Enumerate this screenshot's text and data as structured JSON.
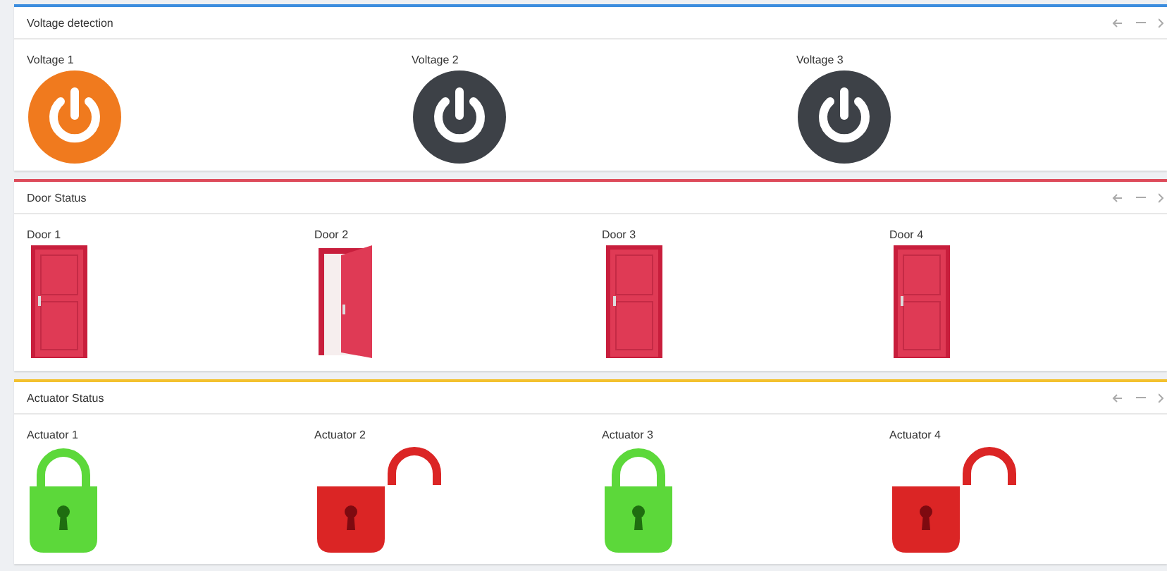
{
  "panels": [
    {
      "title": "Voltage detection",
      "color": "#3c8dde",
      "kind": "power",
      "items": [
        {
          "label": "Voltage 1",
          "on": true
        },
        {
          "label": "Voltage 2",
          "on": false
        },
        {
          "label": "Voltage 3",
          "on": false
        }
      ]
    },
    {
      "title": "Door Status",
      "color": "#dd4b5a",
      "kind": "door",
      "items": [
        {
          "label": "Door 1",
          "open": false
        },
        {
          "label": "Door 2",
          "open": true
        },
        {
          "label": "Door 3",
          "open": false
        },
        {
          "label": "Door 4",
          "open": false
        }
      ]
    },
    {
      "title": "Actuator Status",
      "color": "#f3c12e",
      "kind": "lock",
      "items": [
        {
          "label": "Actuator 1",
          "locked": true
        },
        {
          "label": "Actuator 2",
          "locked": false
        },
        {
          "label": "Actuator 3",
          "locked": true
        },
        {
          "label": "Actuator 4",
          "locked": false
        }
      ]
    }
  ]
}
